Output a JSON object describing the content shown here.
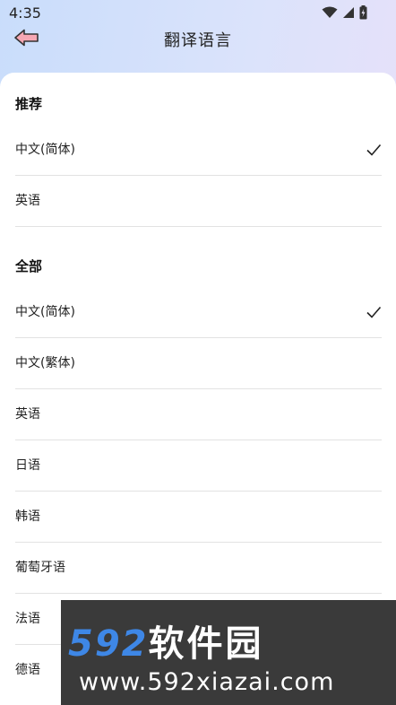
{
  "status_bar": {
    "time": "4:35",
    "icons": [
      "wifi-icon",
      "signal-icon",
      "battery-icon"
    ]
  },
  "header": {
    "title": "翻译语言",
    "back_icon": "back-arrow-icon",
    "back_icon_color": "#f6a7b3"
  },
  "sections": {
    "recommended": {
      "title": "推荐",
      "items": [
        {
          "label": "中文(简体)",
          "selected": true
        },
        {
          "label": "英语",
          "selected": false
        }
      ]
    },
    "all": {
      "title": "全部",
      "items": [
        {
          "label": "中文(简体)",
          "selected": true
        },
        {
          "label": "中文(繁体)",
          "selected": false
        },
        {
          "label": "英语",
          "selected": false
        },
        {
          "label": "日语",
          "selected": false
        },
        {
          "label": "韩语",
          "selected": false
        },
        {
          "label": "葡萄牙语",
          "selected": false
        },
        {
          "label": "法语",
          "selected": false
        },
        {
          "label": "德语",
          "selected": false
        }
      ]
    }
  },
  "watermark": {
    "number": "592",
    "name": "软件园",
    "url": "www.592xiazai.com",
    "accent": "#3e87e6"
  }
}
